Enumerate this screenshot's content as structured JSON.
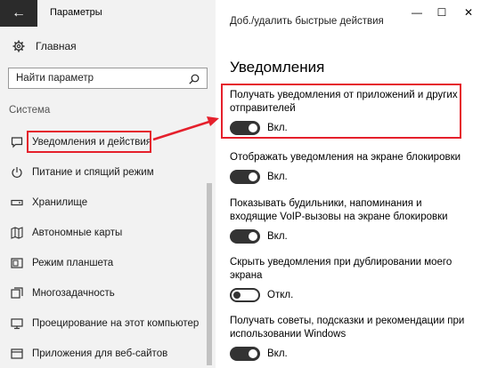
{
  "window": {
    "title": "Параметры",
    "back_glyph": "←",
    "minimize_glyph": "—",
    "maximize_glyph": "☐",
    "close_glyph": "✕"
  },
  "sidebar": {
    "home_label": "Главная",
    "search_placeholder": "Найти параметр",
    "section_label": "Система",
    "items": [
      {
        "label": "Уведомления и действия",
        "icon": "notification-icon"
      },
      {
        "label": "Питание и спящий режим",
        "icon": "power-icon"
      },
      {
        "label": "Хранилище",
        "icon": "storage-icon"
      },
      {
        "label": "Автономные карты",
        "icon": "map-icon"
      },
      {
        "label": "Режим планшета",
        "icon": "tablet-icon"
      },
      {
        "label": "Многозадачность",
        "icon": "multitask-icon"
      },
      {
        "label": "Проецирование на этот компьютер",
        "icon": "projection-icon"
      },
      {
        "label": "Приложения для веб-сайтов",
        "icon": "web-apps-icon"
      }
    ]
  },
  "main": {
    "cut_text": "Доб./удалить быстрые действия",
    "section_title": "Уведомления",
    "settings": [
      {
        "desc": "Получать уведомления от приложений и других отправителей",
        "state": "on",
        "state_label": "Вкл."
      },
      {
        "desc": "Отображать уведомления на экране блокировки",
        "state": "on",
        "state_label": "Вкл."
      },
      {
        "desc": "Показывать будильники, напоминания и входящие VoIP-вызовы на экране блокировки",
        "state": "on",
        "state_label": "Вкл."
      },
      {
        "desc": "Скрыть уведомления при дублировании моего экрана",
        "state": "off",
        "state_label": "Откл."
      },
      {
        "desc": "Получать советы, подсказки и рекомендации при использовании Windows",
        "state": "on",
        "state_label": "Вкл."
      }
    ]
  },
  "colors": {
    "accent_red": "#e5202c",
    "toggle_dark": "#333333",
    "sidebar_bg": "#f2f2f2"
  }
}
